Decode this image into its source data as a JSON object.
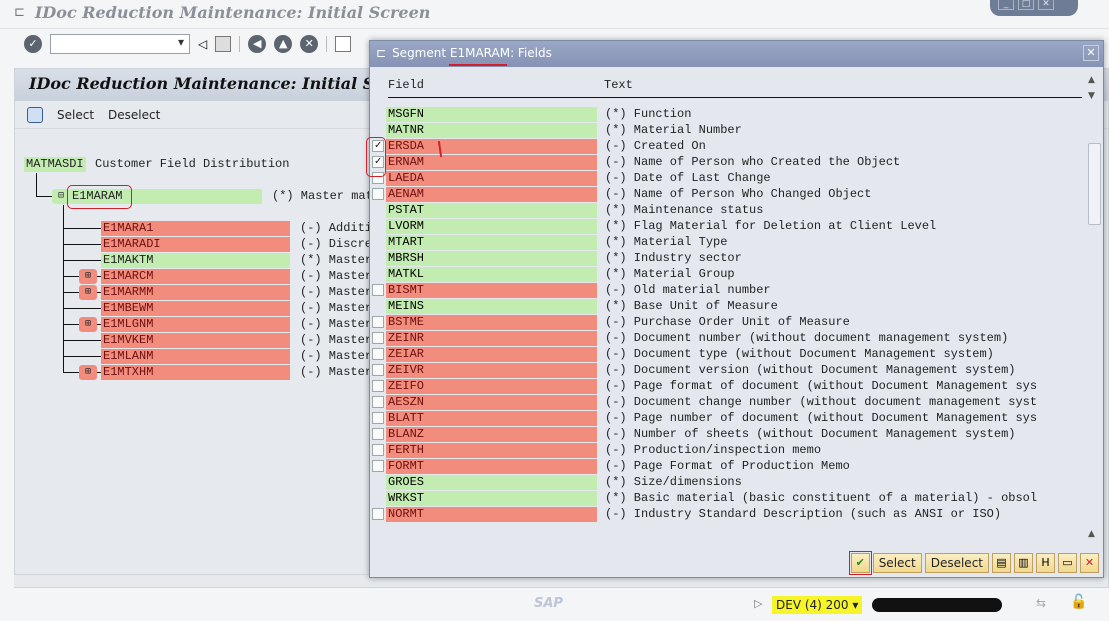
{
  "window": {
    "title": "IDoc Reduction Maintenance: Initial Screen"
  },
  "main": {
    "title": "IDoc Reduction Maintenance: Initial Screen",
    "select_label": "Select",
    "deselect_label": "Deselect"
  },
  "tree": {
    "root": {
      "name": "MATMASDI",
      "text": "Customer Field Distribution"
    },
    "segment": {
      "name": "E1MARAM",
      "text": "(*) Master mat"
    },
    "children": [
      {
        "name": "E1MARA1",
        "text": "(-) Additi",
        "status": "red",
        "expandable": false
      },
      {
        "name": "E1MARADI",
        "text": "(-) Discre",
        "status": "red",
        "expandable": false
      },
      {
        "name": "E1MAKTM",
        "text": "(*) Master",
        "status": "green",
        "expandable": false
      },
      {
        "name": "E1MARCM",
        "text": "(-) Master",
        "status": "red",
        "expandable": true
      },
      {
        "name": "E1MARMM",
        "text": "(-) Master",
        "status": "red",
        "expandable": true
      },
      {
        "name": "E1MBEWM",
        "text": "(-) Master",
        "status": "red",
        "expandable": false
      },
      {
        "name": "E1MLGNM",
        "text": "(-) Master",
        "status": "red",
        "expandable": true
      },
      {
        "name": "E1MVKEM",
        "text": "(-) Master",
        "status": "red",
        "expandable": false
      },
      {
        "name": "E1MLANM",
        "text": "(-) Master",
        "status": "red",
        "expandable": false
      },
      {
        "name": "E1MTXHM",
        "text": "(-) Master",
        "status": "red",
        "expandable": true
      }
    ]
  },
  "dialog": {
    "title": "Segment E1MARAM: Fields",
    "col_field": "Field",
    "col_text": "Text",
    "select_label": "Select",
    "deselect_label": "Deselect",
    "fields": [
      {
        "field": "MSGFN",
        "text": "(*) Function",
        "status": "green"
      },
      {
        "field": "MATNR",
        "text": "(*) Material Number",
        "status": "green"
      },
      {
        "field": "ERSDA",
        "text": "(-) Created On",
        "status": "red",
        "checked": true
      },
      {
        "field": "ERNAM",
        "text": "(-) Name of Person who Created the Object",
        "status": "red",
        "checked": true
      },
      {
        "field": "LAEDA",
        "text": "(-) Date of Last Change",
        "status": "red",
        "checked": false
      },
      {
        "field": "AENAM",
        "text": "(-) Name of Person Who Changed Object",
        "status": "red",
        "checked": false
      },
      {
        "field": "PSTAT",
        "text": "(*) Maintenance status",
        "status": "green"
      },
      {
        "field": "LVORM",
        "text": "(*) Flag Material for Deletion at Client Level",
        "status": "green"
      },
      {
        "field": "MTART",
        "text": "(*) Material Type",
        "status": "green"
      },
      {
        "field": "MBRSH",
        "text": "(*) Industry sector",
        "status": "green"
      },
      {
        "field": "MATKL",
        "text": "(*) Material Group",
        "status": "green"
      },
      {
        "field": "BISMT",
        "text": "(-) Old material number",
        "status": "red",
        "checked": false
      },
      {
        "field": "MEINS",
        "text": "(*) Base Unit of Measure",
        "status": "green"
      },
      {
        "field": "BSTME",
        "text": "(-) Purchase Order Unit of Measure",
        "status": "red",
        "checked": false
      },
      {
        "field": "ZEINR",
        "text": "(-) Document number (without document management system)",
        "status": "red",
        "checked": false
      },
      {
        "field": "ZEIAR",
        "text": "(-) Document type (without Document Management system)",
        "status": "red",
        "checked": false
      },
      {
        "field": "ZEIVR",
        "text": "(-) Document version (without Document Management system)",
        "status": "red",
        "checked": false
      },
      {
        "field": "ZEIFO",
        "text": "(-) Page format of document (without Document Management sys",
        "status": "red",
        "checked": false
      },
      {
        "field": "AESZN",
        "text": "(-) Document change number (without document management syst",
        "status": "red",
        "checked": false
      },
      {
        "field": "BLATT",
        "text": "(-) Page number of document (without Document Management sys",
        "status": "red",
        "checked": false
      },
      {
        "field": "BLANZ",
        "text": "(-) Number of sheets (without Document Management system)",
        "status": "red",
        "checked": false
      },
      {
        "field": "FERTH",
        "text": "(-) Production/inspection memo",
        "status": "red",
        "checked": false
      },
      {
        "field": "FORMT",
        "text": "(-) Page Format of Production Memo",
        "status": "red",
        "checked": false
      },
      {
        "field": "GROES",
        "text": "(*) Size/dimensions",
        "status": "green"
      },
      {
        "field": "WRKST",
        "text": "(*) Basic material (basic constituent of a material) - obsol",
        "status": "green"
      },
      {
        "field": "NORMT",
        "text": "(-) Industry Standard Description (such as ANSI or ISO)",
        "status": "red",
        "checked": false
      }
    ]
  },
  "statusbar": {
    "system": "DEV (4) 200"
  },
  "colors": {
    "green": "#c2ecb0",
    "red": "#f28c7c",
    "highlight": "#f5f52a"
  }
}
